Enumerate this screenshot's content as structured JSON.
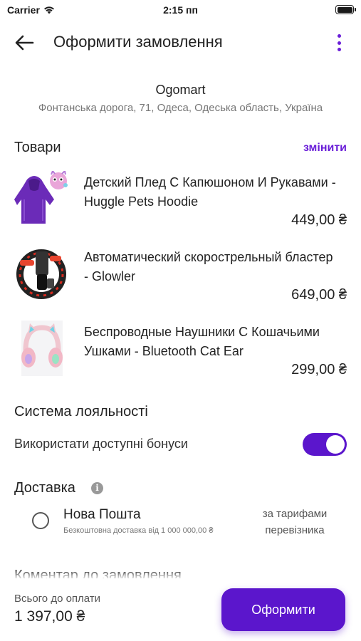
{
  "status_bar": {
    "carrier": "Carrier",
    "time": "2:15 пп"
  },
  "header": {
    "title": "Оформити замовлення"
  },
  "store": {
    "name": "Ogomart",
    "address": "Фонтанська дорога, 71, Одеса, Одеська область, Україна"
  },
  "products": {
    "title": "Товари",
    "change_label": "змінити",
    "items": [
      {
        "name": "Детский Плед С Капюшоном И Рукавами - Huggle Pets Hoodie",
        "price": "449,00 ₴"
      },
      {
        "name": "Автоматический скорострельный бластер - Glowler",
        "price": "649,00 ₴"
      },
      {
        "name": "Беспроводные Наушники С Кошачьими Ушками - Bluetooth Cat Ear",
        "price": "299,00 ₴"
      }
    ]
  },
  "loyalty": {
    "title": "Система лояльності",
    "use_bonuses_label": "Використати доступні бонуси",
    "use_bonuses_enabled": true
  },
  "delivery": {
    "title": "Доставка",
    "options": [
      {
        "name": "Нова Пошта",
        "subtitle": "Безкоштовна доставка від 1 000 000,00 ₴",
        "price_note": "за тарифами перевізника",
        "selected": false
      }
    ]
  },
  "comment": {
    "title": "Коментар до замовлення"
  },
  "footer": {
    "total_label": "Всього до оплати",
    "total_value": "1 397,00 ₴",
    "checkout_label": "Оформити"
  },
  "colors": {
    "accent": "#5b16cc",
    "link": "#6a1ed8"
  }
}
